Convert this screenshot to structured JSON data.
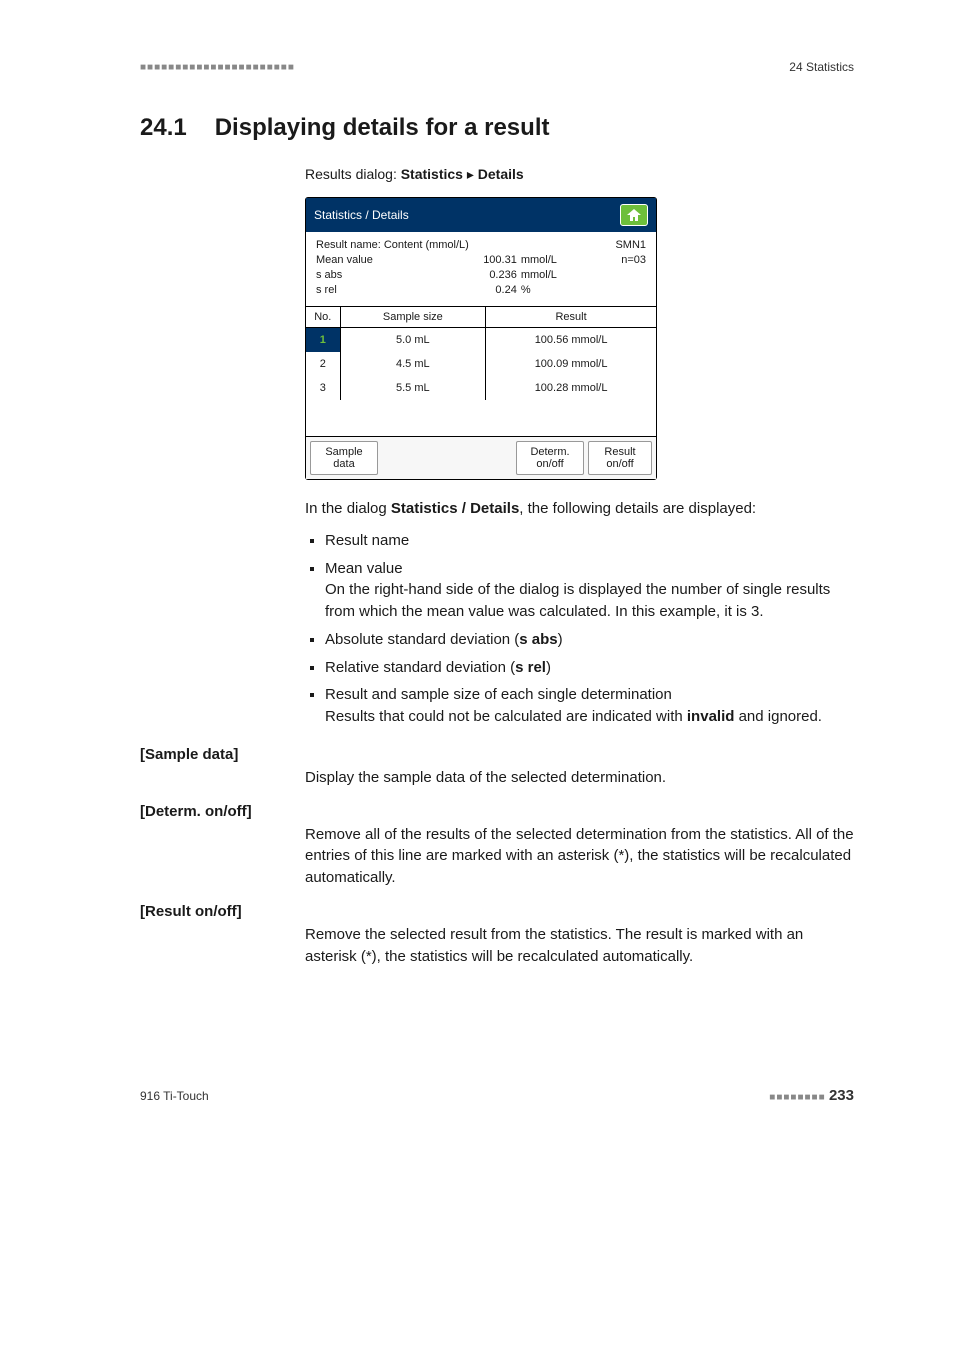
{
  "header": {
    "left_marks": "■■■■■■■■■■■■■■■■■■■■■■",
    "right": "24 Statistics"
  },
  "section": {
    "number": "24.1",
    "title": "Displaying details for a result"
  },
  "breadcrumb": {
    "prefix": "Results dialog: ",
    "a": "Statistics",
    "sep": " ▸ ",
    "b": "Details"
  },
  "dialog": {
    "title": "Statistics / Details",
    "home_icon": "home-icon",
    "summary": {
      "result_name_label": "Result name: Content (mmol/L)",
      "mean_label": "Mean value",
      "sabs_label": "s abs",
      "srel_label": "s rel",
      "mean_val": "100.31",
      "mean_unit": "mmol/L",
      "sabs_val": "0.236",
      "sabs_unit": "mmol/L",
      "srel_val": "0.24",
      "srel_unit": "%",
      "smn": "SMN1",
      "n": "n=03"
    },
    "columns": {
      "no": "No.",
      "sample": "Sample size",
      "result": "Result"
    },
    "rows": [
      {
        "no": "1",
        "sample": "5.0 mL",
        "result": "100.56 mmol/L"
      },
      {
        "no": "2",
        "sample": "4.5 mL",
        "result": "100.09 mmol/L"
      },
      {
        "no": "3",
        "sample": "5.5 mL",
        "result": "100.28 mmol/L"
      }
    ],
    "buttons": {
      "sample": "Sample\ndata",
      "determ": "Determ.\non/off",
      "result": "Result\non/off"
    }
  },
  "intro": {
    "line1_a": "In the dialog ",
    "line1_b": "Statistics / Details",
    "line1_c": ", the following details are displayed:"
  },
  "bullets": {
    "b1": "Result name",
    "b2": "Mean value",
    "b2_sub": "On the right-hand side of the dialog is displayed the number of single results from which the mean value was calculated. In this example, it is 3.",
    "b3_a": "Absolute standard deviation (",
    "b3_b": "s abs",
    "b3_c": ")",
    "b4_a": "Relative standard deviation (",
    "b4_b": "s rel",
    "b4_c": ")",
    "b5_a": "Result and sample size of each single determination",
    "b5_sub_a": "Results that could not be calculated are indicated with ",
    "b5_sub_b": "invalid",
    "b5_sub_c": " and ignored."
  },
  "defs": {
    "t1": "[Sample data]",
    "d1": "Display the sample data of the selected determination.",
    "t2": "[Determ. on/off]",
    "d2": "Remove all of the results of the selected determination from the statistics. All of the entries of this line are marked with an asterisk (*), the statistics will be recalculated automatically.",
    "t3": "[Result on/off]",
    "d3": "Remove the selected result from the statistics. The result is marked with an asterisk (*), the statistics will be recalculated automatically."
  },
  "footer": {
    "left": "916 Ti-Touch",
    "dots": "■■■■■■■■",
    "page": "233"
  }
}
